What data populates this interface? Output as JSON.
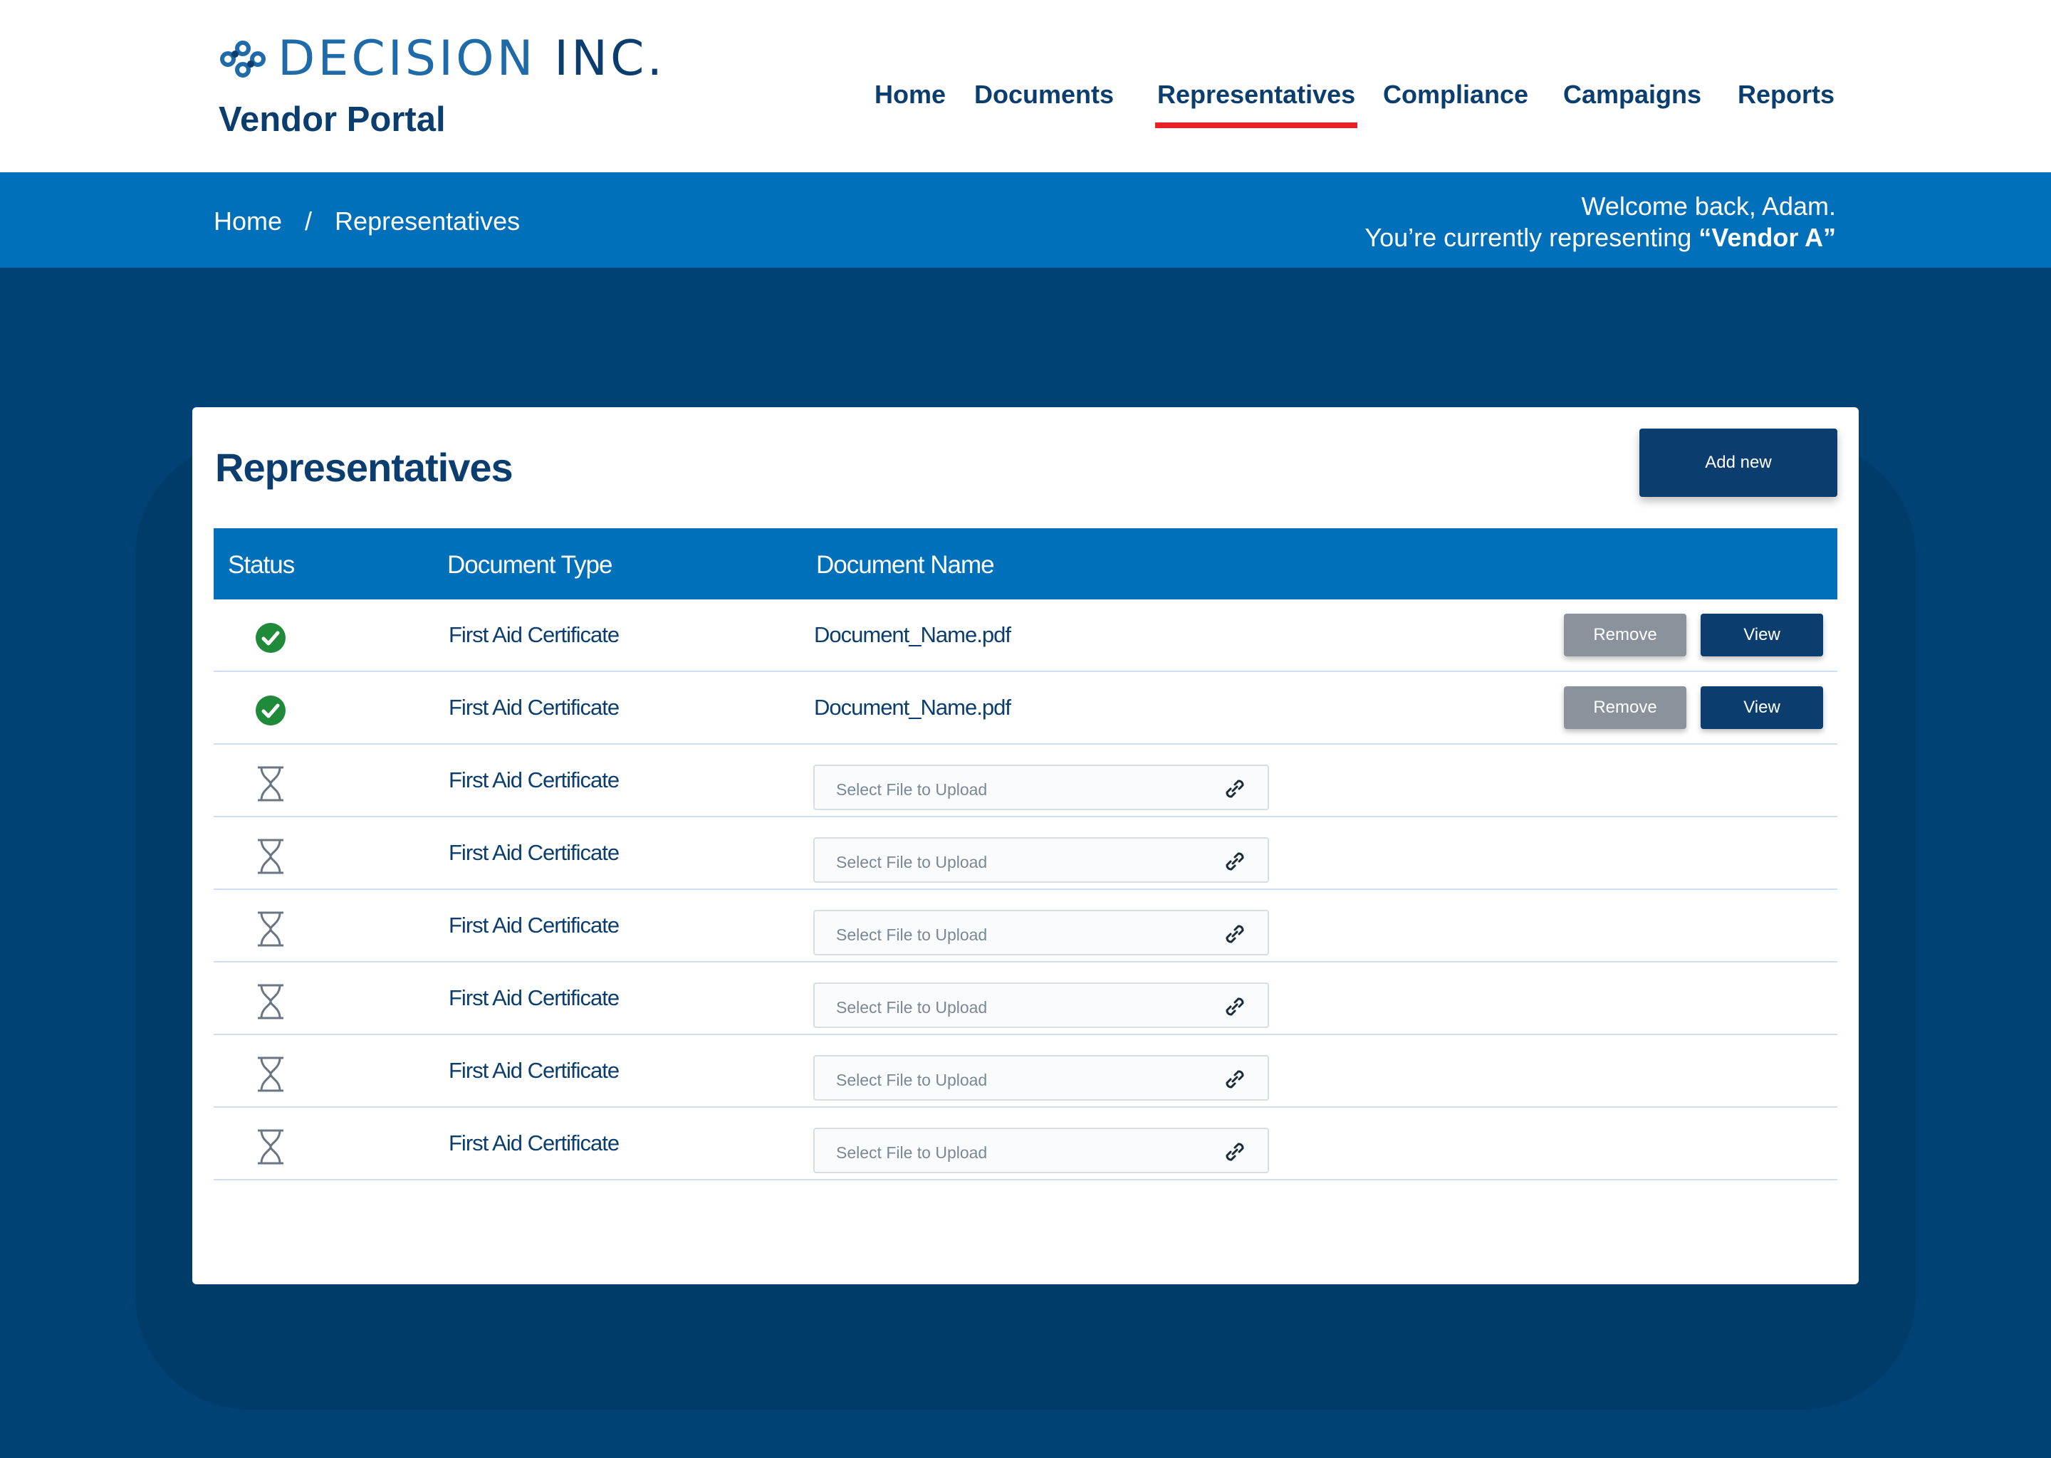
{
  "brand": {
    "name": "DECISION",
    "suffix": "INC.",
    "portal_title": "Vendor Portal",
    "colors": {
      "primary": "#0b3e6f",
      "accent_blue": "#0070bb",
      "active_underline": "#e8202a"
    }
  },
  "nav": {
    "items": [
      {
        "label": "Home"
      },
      {
        "label": "Documents"
      },
      {
        "label": "Representatives",
        "active": true
      },
      {
        "label": "Compliance"
      },
      {
        "label": "Campaigns"
      },
      {
        "label": "Reports"
      }
    ]
  },
  "breadcrumb": {
    "home": "Home",
    "separator": "/",
    "current": "Representatives"
  },
  "welcome": {
    "line1": "Welcome back, Adam.",
    "line2_prefix": "You’re currently representing ",
    "vendor": "“Vendor A”"
  },
  "card": {
    "title": "Representatives",
    "add_button": "Add new"
  },
  "table": {
    "headers": {
      "status": "Status",
      "type": "Document Type",
      "name": "Document Name"
    },
    "rows": [
      {
        "status": "complete",
        "status_icon": "check-circle-icon",
        "type": "First Aid Certificate",
        "name": "Document_Name.pdf",
        "remove": "Remove",
        "view": "View"
      },
      {
        "status": "complete",
        "status_icon": "check-circle-icon",
        "type": "First Aid Certificate",
        "name": "Document_Name.pdf",
        "remove": "Remove",
        "view": "View"
      },
      {
        "status": "pending",
        "status_icon": "hourglass-icon",
        "type": "First Aid Certificate",
        "upload_placeholder": "Select File to Upload"
      },
      {
        "status": "pending",
        "status_icon": "hourglass-icon",
        "type": "First Aid Certificate",
        "upload_placeholder": "Select File to Upload"
      },
      {
        "status": "pending",
        "status_icon": "hourglass-icon",
        "type": "First Aid Certificate",
        "upload_placeholder": "Select File to Upload"
      },
      {
        "status": "pending",
        "status_icon": "hourglass-icon",
        "type": "First Aid Certificate",
        "upload_placeholder": "Select File to Upload"
      },
      {
        "status": "pending",
        "status_icon": "hourglass-icon",
        "type": "First Aid Certificate",
        "upload_placeholder": "Select File to Upload"
      },
      {
        "status": "pending",
        "status_icon": "hourglass-icon",
        "type": "First Aid Certificate",
        "upload_placeholder": "Select File to Upload"
      }
    ]
  }
}
